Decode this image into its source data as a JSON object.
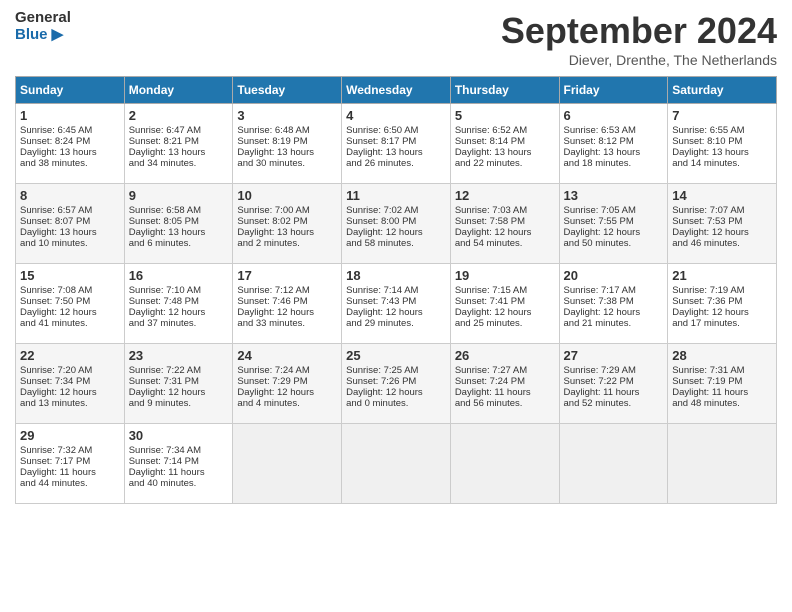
{
  "header": {
    "logo_line1": "General",
    "logo_line2": "Blue",
    "month": "September 2024",
    "location": "Diever, Drenthe, The Netherlands"
  },
  "weekdays": [
    "Sunday",
    "Monday",
    "Tuesday",
    "Wednesday",
    "Thursday",
    "Friday",
    "Saturday"
  ],
  "weeks": [
    [
      {
        "day": "1",
        "lines": [
          "Sunrise: 6:45 AM",
          "Sunset: 8:24 PM",
          "Daylight: 13 hours",
          "and 38 minutes."
        ]
      },
      {
        "day": "2",
        "lines": [
          "Sunrise: 6:47 AM",
          "Sunset: 8:21 PM",
          "Daylight: 13 hours",
          "and 34 minutes."
        ]
      },
      {
        "day": "3",
        "lines": [
          "Sunrise: 6:48 AM",
          "Sunset: 8:19 PM",
          "Daylight: 13 hours",
          "and 30 minutes."
        ]
      },
      {
        "day": "4",
        "lines": [
          "Sunrise: 6:50 AM",
          "Sunset: 8:17 PM",
          "Daylight: 13 hours",
          "and 26 minutes."
        ]
      },
      {
        "day": "5",
        "lines": [
          "Sunrise: 6:52 AM",
          "Sunset: 8:14 PM",
          "Daylight: 13 hours",
          "and 22 minutes."
        ]
      },
      {
        "day": "6",
        "lines": [
          "Sunrise: 6:53 AM",
          "Sunset: 8:12 PM",
          "Daylight: 13 hours",
          "and 18 minutes."
        ]
      },
      {
        "day": "7",
        "lines": [
          "Sunrise: 6:55 AM",
          "Sunset: 8:10 PM",
          "Daylight: 13 hours",
          "and 14 minutes."
        ]
      }
    ],
    [
      {
        "day": "8",
        "lines": [
          "Sunrise: 6:57 AM",
          "Sunset: 8:07 PM",
          "Daylight: 13 hours",
          "and 10 minutes."
        ]
      },
      {
        "day": "9",
        "lines": [
          "Sunrise: 6:58 AM",
          "Sunset: 8:05 PM",
          "Daylight: 13 hours",
          "and 6 minutes."
        ]
      },
      {
        "day": "10",
        "lines": [
          "Sunrise: 7:00 AM",
          "Sunset: 8:02 PM",
          "Daylight: 13 hours",
          "and 2 minutes."
        ]
      },
      {
        "day": "11",
        "lines": [
          "Sunrise: 7:02 AM",
          "Sunset: 8:00 PM",
          "Daylight: 12 hours",
          "and 58 minutes."
        ]
      },
      {
        "day": "12",
        "lines": [
          "Sunrise: 7:03 AM",
          "Sunset: 7:58 PM",
          "Daylight: 12 hours",
          "and 54 minutes."
        ]
      },
      {
        "day": "13",
        "lines": [
          "Sunrise: 7:05 AM",
          "Sunset: 7:55 PM",
          "Daylight: 12 hours",
          "and 50 minutes."
        ]
      },
      {
        "day": "14",
        "lines": [
          "Sunrise: 7:07 AM",
          "Sunset: 7:53 PM",
          "Daylight: 12 hours",
          "and 46 minutes."
        ]
      }
    ],
    [
      {
        "day": "15",
        "lines": [
          "Sunrise: 7:08 AM",
          "Sunset: 7:50 PM",
          "Daylight: 12 hours",
          "and 41 minutes."
        ]
      },
      {
        "day": "16",
        "lines": [
          "Sunrise: 7:10 AM",
          "Sunset: 7:48 PM",
          "Daylight: 12 hours",
          "and 37 minutes."
        ]
      },
      {
        "day": "17",
        "lines": [
          "Sunrise: 7:12 AM",
          "Sunset: 7:46 PM",
          "Daylight: 12 hours",
          "and 33 minutes."
        ]
      },
      {
        "day": "18",
        "lines": [
          "Sunrise: 7:14 AM",
          "Sunset: 7:43 PM",
          "Daylight: 12 hours",
          "and 29 minutes."
        ]
      },
      {
        "day": "19",
        "lines": [
          "Sunrise: 7:15 AM",
          "Sunset: 7:41 PM",
          "Daylight: 12 hours",
          "and 25 minutes."
        ]
      },
      {
        "day": "20",
        "lines": [
          "Sunrise: 7:17 AM",
          "Sunset: 7:38 PM",
          "Daylight: 12 hours",
          "and 21 minutes."
        ]
      },
      {
        "day": "21",
        "lines": [
          "Sunrise: 7:19 AM",
          "Sunset: 7:36 PM",
          "Daylight: 12 hours",
          "and 17 minutes."
        ]
      }
    ],
    [
      {
        "day": "22",
        "lines": [
          "Sunrise: 7:20 AM",
          "Sunset: 7:34 PM",
          "Daylight: 12 hours",
          "and 13 minutes."
        ]
      },
      {
        "day": "23",
        "lines": [
          "Sunrise: 7:22 AM",
          "Sunset: 7:31 PM",
          "Daylight: 12 hours",
          "and 9 minutes."
        ]
      },
      {
        "day": "24",
        "lines": [
          "Sunrise: 7:24 AM",
          "Sunset: 7:29 PM",
          "Daylight: 12 hours",
          "and 4 minutes."
        ]
      },
      {
        "day": "25",
        "lines": [
          "Sunrise: 7:25 AM",
          "Sunset: 7:26 PM",
          "Daylight: 12 hours",
          "and 0 minutes."
        ]
      },
      {
        "day": "26",
        "lines": [
          "Sunrise: 7:27 AM",
          "Sunset: 7:24 PM",
          "Daylight: 11 hours",
          "and 56 minutes."
        ]
      },
      {
        "day": "27",
        "lines": [
          "Sunrise: 7:29 AM",
          "Sunset: 7:22 PM",
          "Daylight: 11 hours",
          "and 52 minutes."
        ]
      },
      {
        "day": "28",
        "lines": [
          "Sunrise: 7:31 AM",
          "Sunset: 7:19 PM",
          "Daylight: 11 hours",
          "and 48 minutes."
        ]
      }
    ],
    [
      {
        "day": "29",
        "lines": [
          "Sunrise: 7:32 AM",
          "Sunset: 7:17 PM",
          "Daylight: 11 hours",
          "and 44 minutes."
        ]
      },
      {
        "day": "30",
        "lines": [
          "Sunrise: 7:34 AM",
          "Sunset: 7:14 PM",
          "Daylight: 11 hours",
          "and 40 minutes."
        ]
      },
      {
        "day": "",
        "lines": []
      },
      {
        "day": "",
        "lines": []
      },
      {
        "day": "",
        "lines": []
      },
      {
        "day": "",
        "lines": []
      },
      {
        "day": "",
        "lines": []
      }
    ]
  ]
}
